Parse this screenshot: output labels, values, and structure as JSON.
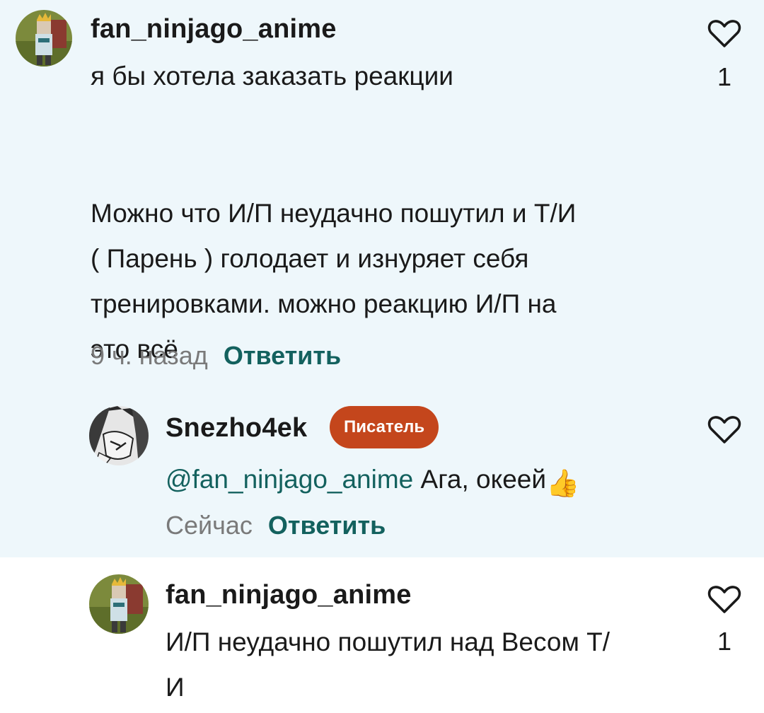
{
  "comments": [
    {
      "username": "fan_ninjago_anime",
      "text_lines": [
        "я бы хотела заказать реакции",
        "",
        "Можно что И/П неудачно пошутил и Т/И",
        "( Парень ) голодает и изнуряет себя",
        "тренировками. можно реакцию И/П на",
        "это всё"
      ],
      "time": "9 ч. назад",
      "reply_label": "Ответить",
      "like_count": "1"
    },
    {
      "username": "Snezho4ek",
      "badge": "Писатель",
      "mention": "@fan_ninjago_anime",
      "text": " Ага, океей",
      "emoji": "👍",
      "time": "Сейчас",
      "reply_label": "Ответить"
    },
    {
      "username": "fan_ninjago_anime",
      "text_lines": [
        "И/П неудачно пошутил над Весом Т/",
        "И"
      ],
      "like_count": "1"
    }
  ],
  "icons": {
    "like": "heart-outline-icon"
  },
  "colors": {
    "highlight_bg": "#eef7fb",
    "reply": "#13615e",
    "badge": "#c4461c",
    "time": "#7a7a7a"
  }
}
